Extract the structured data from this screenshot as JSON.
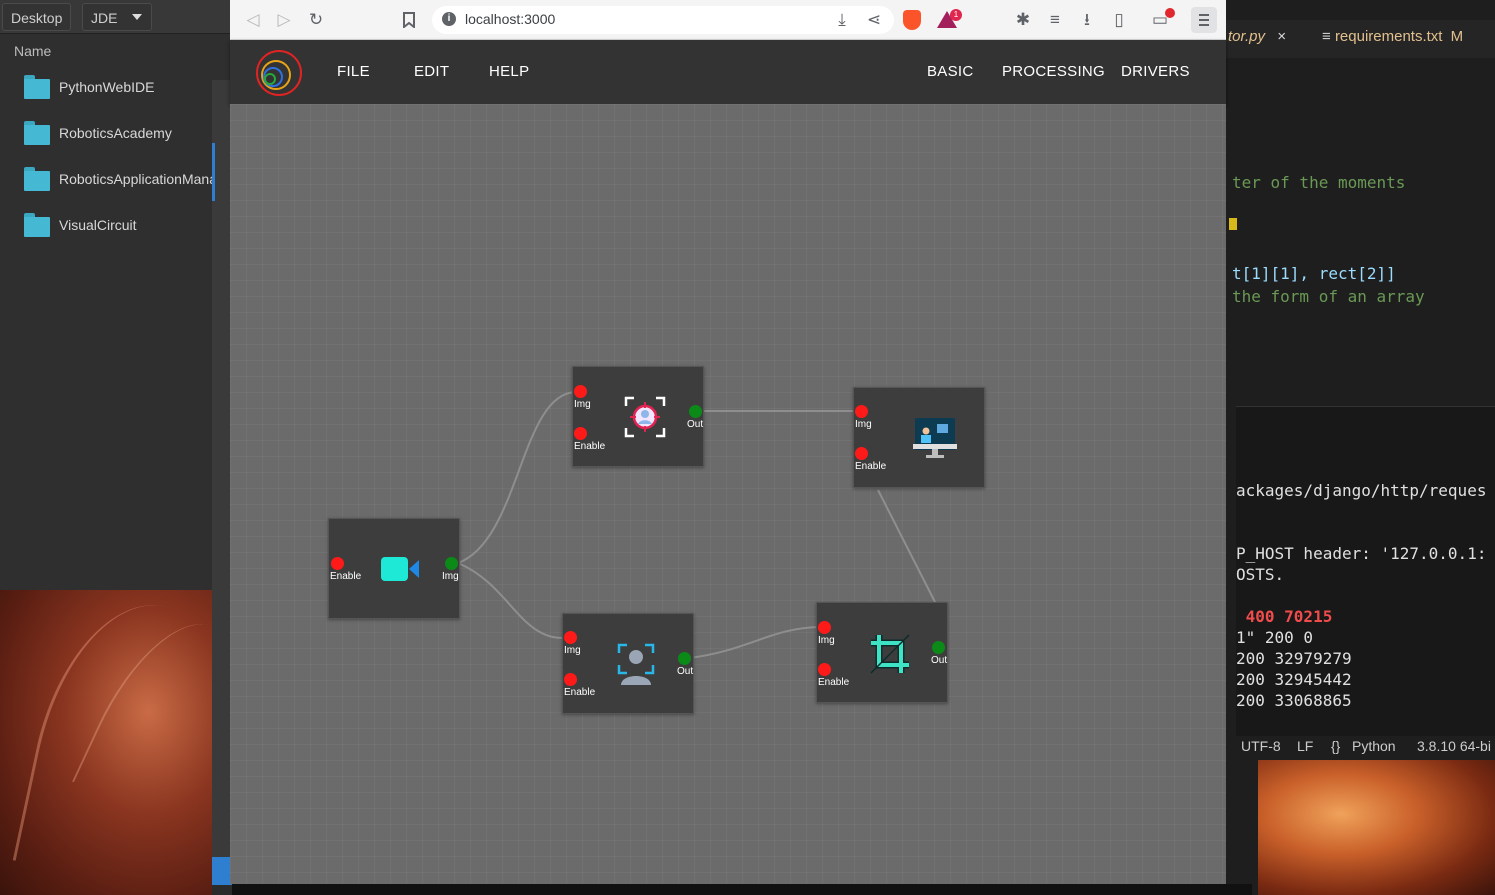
{
  "file_manager": {
    "breadcrumbs": [
      "Desktop",
      "JDE"
    ],
    "column_name": "Name",
    "items": [
      {
        "label": "PythonWebIDE",
        "icon": "folder-icon"
      },
      {
        "label": "RoboticsAcademy",
        "icon": "folder-icon"
      },
      {
        "label": "RoboticsApplicationManager",
        "icon": "folder-icon"
      },
      {
        "label": "VisualCircuit",
        "icon": "folder-icon"
      }
    ]
  },
  "browser": {
    "url": "localhost:3000",
    "rewards_badge": "1"
  },
  "app": {
    "left_menu": [
      "FILE",
      "EDIT",
      "HELP"
    ],
    "right_menu": [
      "BASIC",
      "PROCESSING",
      "DRIVERS"
    ]
  },
  "blocks": {
    "camera": {
      "icon": "video-camera-icon",
      "ports": {
        "enable": "Enable",
        "img": "Img"
      }
    },
    "face_detector": {
      "icon": "face-detection-icon",
      "ports": {
        "img": "Img",
        "enable": "Enable",
        "out": "Out"
      }
    },
    "screen": {
      "icon": "screen-display-icon",
      "ports": {
        "img": "Img",
        "enable": "Enable"
      }
    },
    "person_detector": {
      "icon": "person-detection-icon",
      "ports": {
        "img": "Img",
        "enable": "Enable",
        "out": "Out"
      }
    },
    "crop": {
      "icon": "crop-icon",
      "ports": {
        "img": "Img",
        "enable": "Enable",
        "out": "Out"
      }
    }
  },
  "editor": {
    "tabs": [
      {
        "label": "tor.py",
        "close": "×"
      },
      {
        "label": "requirements.txt",
        "badge": "M"
      }
    ],
    "code_lines": [
      "ter of the moments",
      "t[1][1], rect[2]]",
      "the form of an array"
    ],
    "terminal_lines": [
      "ackages/django/http/reques",
      "P_HOST header: '127.0.0.1:",
      "OSTS.",
      " 400 70215",
      "1\" 200 0",
      "200 32979279",
      "200 32945442",
      "200 33068865"
    ],
    "status": [
      "UTF-8",
      "LF",
      "Python",
      "3.8.10 64-bi"
    ]
  }
}
